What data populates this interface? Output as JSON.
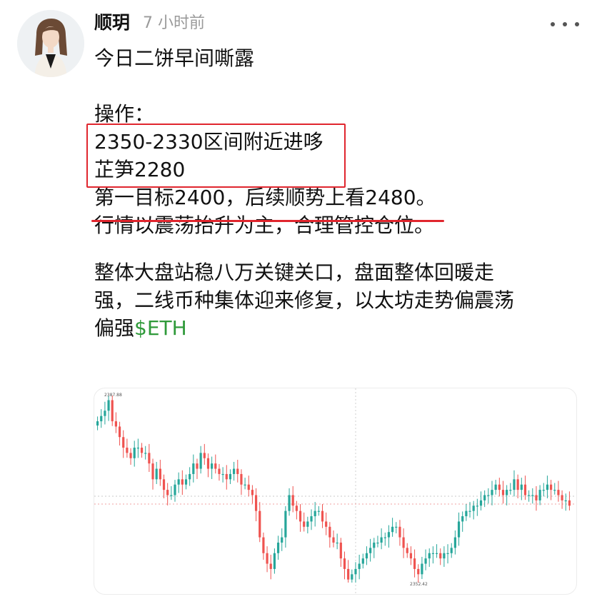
{
  "post": {
    "author": "顺玥",
    "time": "7 小时前",
    "lines": [
      "今日二饼早间嘶露",
      "",
      "操作：",
      "2350-2330区间附近进哆",
      "芷笋2280",
      "第一目标2400，后续顺势上看2480。",
      "行情以震荡抬升为主，合理管控仓位。",
      "",
      "整体大盘站稳八万关键关口，盘面整体回暖走",
      "强，二线币种集体迎来修复，以太坊走势偏震荡",
      "偏强"
    ],
    "ticker": "$ETH"
  },
  "chart": {
    "high_label": "2387.88",
    "low_label": "2352.42",
    "colors": {
      "up": "#26a69a",
      "down": "#ef5350",
      "highlight_box": "#e0262e",
      "ticker": "#2f9a3a"
    }
  },
  "chart_data": {
    "type": "candlestick",
    "high": 2387.88,
    "low": 2352.42,
    "closes": [
      2383,
      2384,
      2385,
      2387,
      2383,
      2382,
      2380,
      2378,
      2377,
      2376,
      2378,
      2378,
      2377,
      2377,
      2375,
      2372,
      2374,
      2372,
      2370,
      2369,
      2369,
      2371,
      2372,
      2371,
      2372,
      2373,
      2375,
      2374,
      2377,
      2376,
      2374,
      2375,
      2374,
      2373,
      2373,
      2372,
      2373,
      2374,
      2373,
      2371,
      2371,
      2370,
      2369,
      2366,
      2361,
      2358,
      2356,
      2355,
      2358,
      2360,
      2361,
      2366,
      2369,
      2367,
      2366,
      2364,
      2363,
      2364,
      2365,
      2366,
      2366,
      2364,
      2363,
      2361,
      2360,
      2360,
      2357,
      2355,
      2353,
      2354,
      2355,
      2356,
      2357,
      2358,
      2359,
      2360,
      2360,
      2361,
      2361,
      2362,
      2363,
      2363,
      2361,
      2359,
      2358,
      2357,
      2355,
      2354,
      2356,
      2357,
      2358,
      2358,
      2358,
      2357,
      2358,
      2358,
      2359,
      2361,
      2364,
      2365,
      2366,
      2366,
      2367,
      2367,
      2368,
      2369,
      2369,
      2370,
      2371,
      2370,
      2369,
      2370,
      2370,
      2372,
      2370,
      2371,
      2369,
      2369,
      2369,
      2368,
      2370,
      2370,
      2371,
      2370,
      2370,
      2369,
      2368,
      2368,
      2367
    ]
  }
}
